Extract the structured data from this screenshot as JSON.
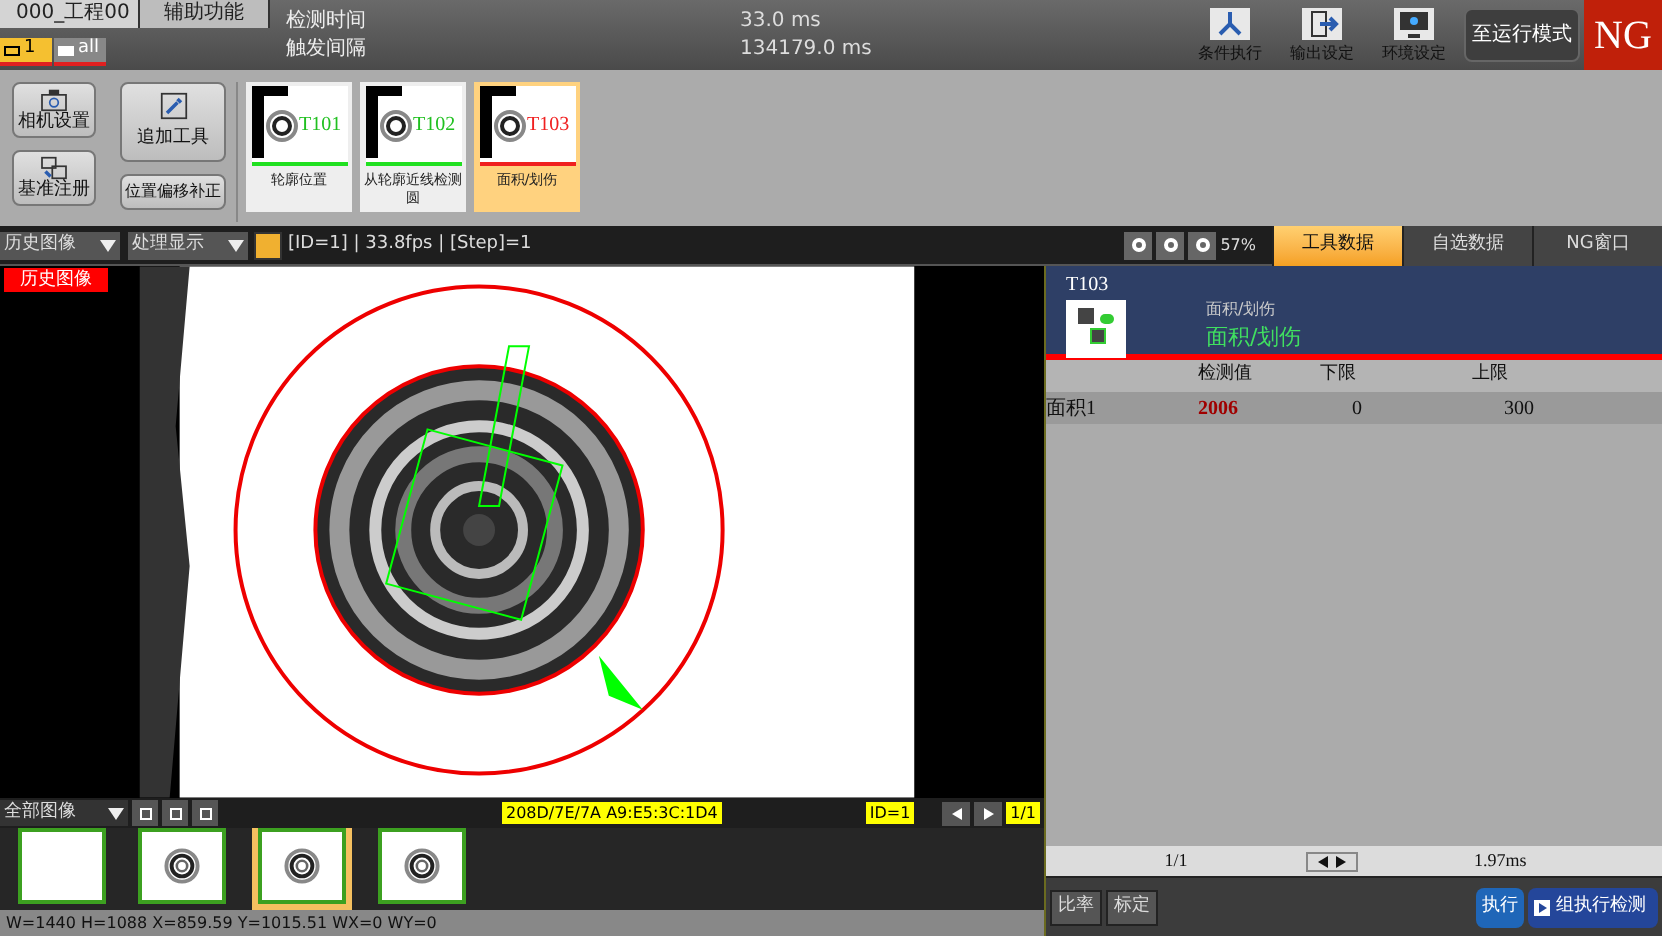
{
  "top_bar": {
    "menus": [
      {
        "label": "000_工程00",
        "selected": true
      },
      {
        "label": "辅助功能",
        "selected": false
      }
    ],
    "cameras": [
      {
        "label": "1",
        "selected": true
      },
      {
        "label": "all",
        "selected": false
      }
    ],
    "timing": [
      {
        "label": "检测时间",
        "value": "33.0 ms"
      },
      {
        "label": "触发间隔",
        "value": "134179.0 ms"
      }
    ],
    "actions": [
      {
        "label": "条件执行"
      },
      {
        "label": "输出设定"
      },
      {
        "label": "环境设定"
      }
    ],
    "mode_button": "至运行模式",
    "result": "NG"
  },
  "toolbar": {
    "buttons": [
      {
        "label": "相机设置"
      },
      {
        "label": "基准注册"
      }
    ],
    "buttons2": [
      {
        "label": "追加工具"
      },
      {
        "label": "位置偏移补正"
      }
    ],
    "tools": [
      {
        "id": "T101",
        "label": "轮廓位置",
        "ok": true,
        "selected": false
      },
      {
        "id": "T102",
        "label": "从轮廓近线检测圆",
        "ok": true,
        "selected": false
      },
      {
        "id": "T103",
        "label": "面积/划伤",
        "ok": false,
        "selected": true
      }
    ]
  },
  "view_bar": {
    "history": "历史图像",
    "display": "处理显示",
    "info": "[ID=1] | 33.8fps | [Step]=1",
    "zoom": "57%",
    "tabs": [
      {
        "label": "工具数据",
        "selected": true
      },
      {
        "label": "自选数据",
        "selected": false
      },
      {
        "label": "NG窗口",
        "selected": false
      }
    ]
  },
  "image": {
    "badge": "历史图像"
  },
  "image_bar": {
    "filter": "全部图像",
    "mac": "208D/7E/7A A9:E5:3C:1D4",
    "id": "ID=1",
    "page": "1/1"
  },
  "thumbnails": [
    {
      "selected": false,
      "kind": "blank"
    },
    {
      "selected": false,
      "kind": "ring"
    },
    {
      "selected": true,
      "kind": "ring"
    },
    {
      "selected": false,
      "kind": "ring"
    }
  ],
  "status_line": "W=1440 H=1088 X=859.59 Y=1015.51 WX=0 WY=0",
  "tool_panel": {
    "id": "T103",
    "type": "面积/划伤",
    "name": "面积/划伤",
    "columns": [
      "检测值",
      "下限",
      "上限"
    ],
    "rows": [
      {
        "name": "面积1",
        "value": "2006",
        "ok": false,
        "lower": "0",
        "upper": "300"
      }
    ],
    "page": "1/1",
    "time": "1.97ms",
    "buttons": [
      "比率",
      "标定"
    ],
    "run": "执行",
    "group_run": "组执行检测"
  }
}
